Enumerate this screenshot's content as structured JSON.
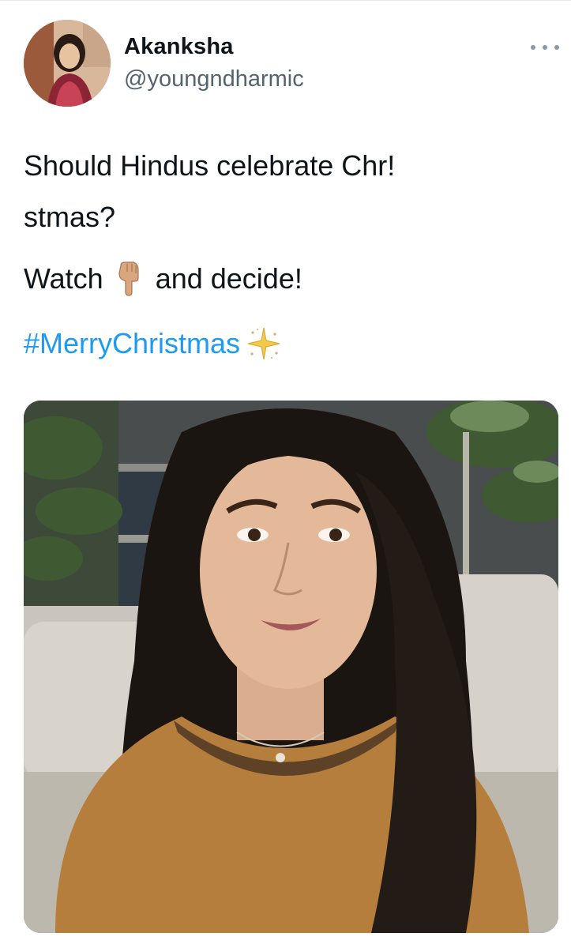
{
  "tweet": {
    "author": {
      "display_name": "Akanksha",
      "username": "@youngndharmic",
      "avatar_icon": "profile-photo"
    },
    "more_icon": "more-horizontal-icon",
    "text": {
      "line1": "Should Hindus celebrate Chr!",
      "line2": "stmas?",
      "line3_before": "Watch",
      "line3_emoji": "backhand-index-pointing-down-emoji",
      "line3_after": "and decide!",
      "hashtag": "#MerryChristmas",
      "hashtag_emoji": "sparkle-emoji"
    },
    "media": {
      "type": "video",
      "preview_description": "woman-with-long-dark-hair-speaking"
    },
    "colors": {
      "text": "#0f1419",
      "secondary": "#536471",
      "link": "#1d9bf0",
      "background": "#ffffff"
    }
  }
}
